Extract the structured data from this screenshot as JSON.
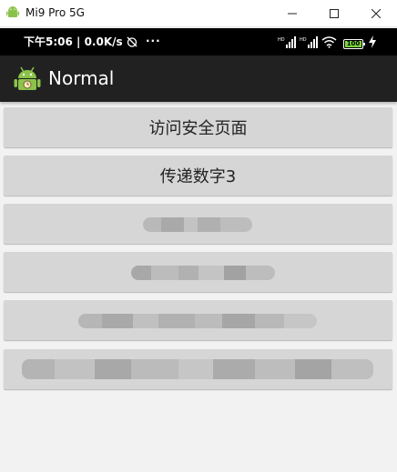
{
  "window": {
    "title": "Mi9 Pro 5G",
    "controls": [
      "minimize-icon",
      "maximize-icon",
      "close-icon"
    ]
  },
  "status_bar": {
    "time_and_speed": "下午5:06 | 0.0K/s",
    "more": "···",
    "battery_level": "100",
    "icons": [
      "alarm-off-icon",
      "signal-hd-icon",
      "signal-hd-icon",
      "wifi-icon",
      "battery-icon",
      "charging-icon"
    ]
  },
  "action_bar": {
    "title": "Normal",
    "icon": "android-launcher-icon"
  },
  "buttons": [
    {
      "label": "访问安全页面"
    },
    {
      "label": "传递数字3"
    },
    {
      "label": ""
    },
    {
      "label": ""
    },
    {
      "label": ""
    },
    {
      "label": ""
    }
  ],
  "colors": {
    "status_bar": "#000000",
    "action_bar": "#212121",
    "background": "#f2f2f2",
    "button": "#d6d6d6",
    "battery_fill": "#7bd63a"
  }
}
